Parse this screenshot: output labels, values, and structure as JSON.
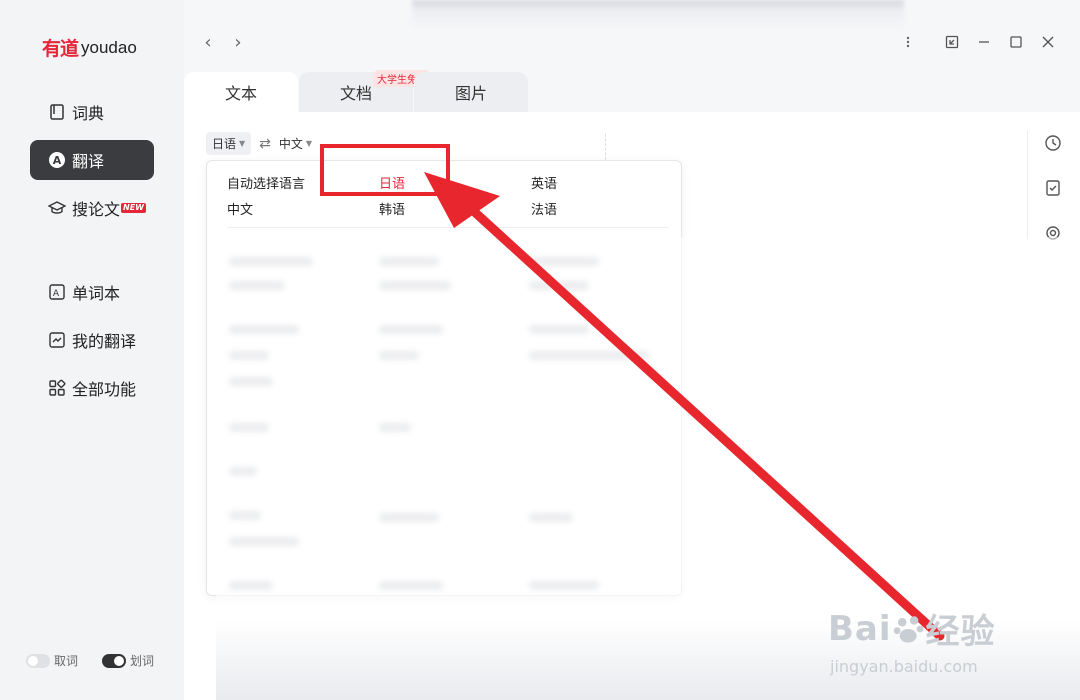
{
  "brand": {
    "logo_cn": "有道",
    "logo_en": "youdao"
  },
  "sidebar": {
    "items": [
      {
        "label": "词典",
        "icon": "book-icon",
        "active": false
      },
      {
        "label": "翻译",
        "icon": "translate-icon",
        "active": true
      },
      {
        "label": "搜论文",
        "icon": "graduation-cap-icon",
        "active": false,
        "badge": "NEW"
      },
      {
        "label": "单词本",
        "icon": "wordbook-icon",
        "active": false
      },
      {
        "label": "我的翻译",
        "icon": "my-translation-icon",
        "active": false
      },
      {
        "label": "全部功能",
        "icon": "grid-icon",
        "active": false
      }
    ],
    "toggles": [
      {
        "label": "取词",
        "on": false
      },
      {
        "label": "划词",
        "on": true
      }
    ]
  },
  "tabs": [
    {
      "label": "文本",
      "active": true
    },
    {
      "label": "文档",
      "active": false,
      "badge": "大学生免费"
    },
    {
      "label": "图片",
      "active": false
    }
  ],
  "language_bar": {
    "source": "日语",
    "target": "中文",
    "swap_icon": "⇄"
  },
  "dropdown": {
    "options": [
      {
        "label": "自动选择语言",
        "selected": false
      },
      {
        "label": "日语",
        "selected": true
      },
      {
        "label": "英语",
        "selected": false
      },
      {
        "label": "中文",
        "selected": false
      },
      {
        "label": "韩语",
        "selected": false
      },
      {
        "label": "法语",
        "selected": false
      }
    ]
  },
  "watermark": {
    "brand": "Bai",
    "brand_cn": "经验",
    "url": "jingyan.baidu.com"
  },
  "colors": {
    "accent": "#e8263a",
    "active_nav": "#3a3c40",
    "annotation": "#e8262d"
  }
}
